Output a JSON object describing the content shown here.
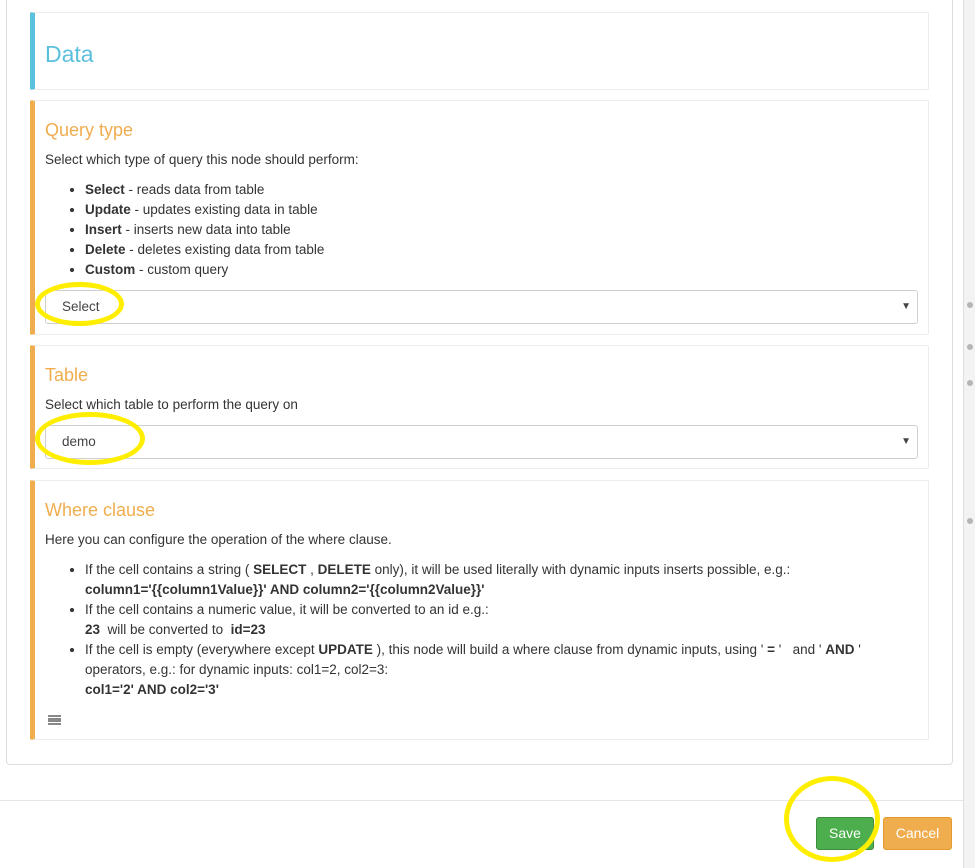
{
  "data_panel": {
    "title": "Data"
  },
  "query_type": {
    "title": "Query type",
    "description": "Select which type of query this node should perform:",
    "items": [
      {
        "term": "Select",
        "text": " - reads data from table"
      },
      {
        "term": "Update",
        "text": " - updates existing data in table"
      },
      {
        "term": "Insert",
        "text": " - inserts new data into table"
      },
      {
        "term": "Delete",
        "text": " - deletes existing data from table"
      },
      {
        "term": "Custom",
        "text": " - custom query"
      }
    ],
    "selected": "Select"
  },
  "table": {
    "title": "Table",
    "description": "Select which table to perform the query on",
    "selected": "demo"
  },
  "where_clause": {
    "title": "Where clause",
    "description": "Here you can configure the operation of the where clause.",
    "b1_pre": "If the cell contains a string ( ",
    "b1_select": "SELECT",
    "b1_comma": " , ",
    "b1_delete": "DELETE",
    "b1_post": " only), it will be used literally with dynamic inputs inserts possible, e.g.:",
    "b1_example": "column1='{{column1Value}}' AND column2='{{column2Value}}'",
    "b2_text": "If the cell contains a numeric value, it will be converted to an id e.g.:",
    "b2_num": "23",
    "b2_mid": "  will be converted to  ",
    "b2_id": "id=23",
    "b3_pre": "If the cell is empty (everywhere except ",
    "b3_update": "UPDATE",
    "b3_mid1": " ), this node will build a where clause from dynamic inputs, using ' ",
    "b3_eq": "=",
    "b3_mid2": " '   and ' ",
    "b3_and": "AND",
    "b3_post": " ' operators, e.g.: for dynamic inputs: col1=2, col2=3:",
    "b3_example": "col1='2' AND col2='3'"
  },
  "footer": {
    "save_label": "Save",
    "cancel_label": "Cancel"
  },
  "colors": {
    "info_accent": "#5bc0de",
    "warning_accent": "#f0ad4e",
    "save_button": "#4cae4c",
    "cancel_button": "#f0ad4e",
    "highlight_marker": "#ffee00"
  },
  "icons": {
    "select_caret": "caret-down-icon",
    "drag_handle": "menu-lines-icon"
  }
}
